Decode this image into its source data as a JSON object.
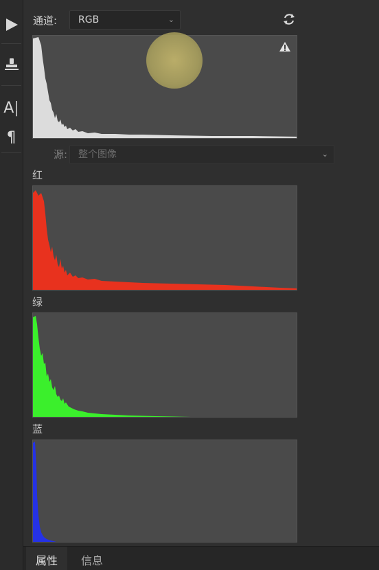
{
  "channel": {
    "label": "通道:",
    "value": "RGB"
  },
  "source": {
    "label": "源:",
    "value": "整个图像"
  },
  "histograms": [
    {
      "label": "",
      "color": "#dcdcdc"
    },
    {
      "label": "红",
      "color": "#e8321e"
    },
    {
      "label": "绿",
      "color": "#3bef2c"
    },
    {
      "label": "蓝",
      "color": "#2532e6"
    }
  ],
  "tabs": [
    {
      "label": "属性",
      "active": true
    },
    {
      "label": "信息",
      "active": false
    }
  ],
  "icons": {
    "refresh": "refresh-icon",
    "warning": "warning-icon",
    "play": "play-icon",
    "stamp": "stamp-icon",
    "text": "text-tool-icon",
    "paragraph": "paragraph-icon"
  }
}
